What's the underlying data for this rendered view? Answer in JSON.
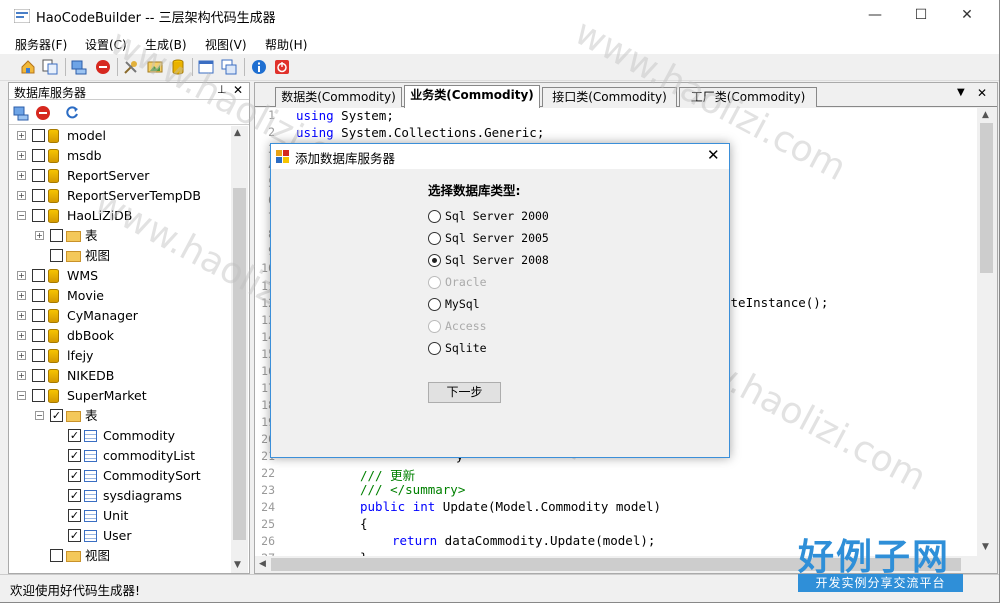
{
  "window": {
    "title": "HaoCodeBuilder -- 三层架构代码生成器",
    "minimize": "—",
    "maximize": "☐",
    "close": "✕"
  },
  "menu": [
    "服务器(F)",
    "设置(C)",
    "生成(B)",
    "视图(V)",
    "帮助(H)"
  ],
  "toolbar_icons": [
    "home-icon",
    "copy-icon",
    "server-add-icon",
    "stop-icon",
    "tools-icon",
    "image-icon",
    "database-icon",
    "window-icon",
    "windows-icon",
    "info-icon",
    "exit-icon"
  ],
  "left_panel": {
    "title": "数据库服务器",
    "pin": "⊥",
    "close": "✕",
    "tools": [
      "server-add-icon",
      "delete-icon",
      "refresh-icon"
    ],
    "tree": [
      {
        "label": "model",
        "level": 0,
        "type": "db",
        "expander": "+",
        "checked": false
      },
      {
        "label": "msdb",
        "level": 0,
        "type": "db",
        "expander": "+",
        "checked": false
      },
      {
        "label": "ReportServer",
        "level": 0,
        "type": "db",
        "expander": "+",
        "checked": false
      },
      {
        "label": "ReportServerTempDB",
        "level": 0,
        "type": "db",
        "expander": "+",
        "checked": false
      },
      {
        "label": "HaoLiZiDB",
        "level": 0,
        "type": "db",
        "expander": "−",
        "checked": false
      },
      {
        "label": "表",
        "level": 1,
        "type": "folder",
        "expander": "+",
        "checked": false
      },
      {
        "label": "视图",
        "level": 1,
        "type": "folder",
        "expander": "",
        "checked": false
      },
      {
        "label": "WMS",
        "level": 0,
        "type": "db",
        "expander": "+",
        "checked": false
      },
      {
        "label": "Movie",
        "level": 0,
        "type": "db",
        "expander": "+",
        "checked": false
      },
      {
        "label": "CyManager",
        "level": 0,
        "type": "db",
        "expander": "+",
        "checked": false
      },
      {
        "label": "dbBook",
        "level": 0,
        "type": "db",
        "expander": "+",
        "checked": false
      },
      {
        "label": "lfejy",
        "level": 0,
        "type": "db",
        "expander": "+",
        "checked": false
      },
      {
        "label": "NIKEDB",
        "level": 0,
        "type": "db",
        "expander": "+",
        "checked": false
      },
      {
        "label": "SuperMarket",
        "level": 0,
        "type": "db",
        "expander": "−",
        "checked": false
      },
      {
        "label": "表",
        "level": 1,
        "type": "folder",
        "expander": "−",
        "checked": true
      },
      {
        "label": "Commodity",
        "level": 2,
        "type": "table",
        "expander": "",
        "checked": true
      },
      {
        "label": "commodityList",
        "level": 2,
        "type": "table",
        "expander": "",
        "checked": true
      },
      {
        "label": "CommoditySort",
        "level": 2,
        "type": "table",
        "expander": "",
        "checked": true
      },
      {
        "label": "sysdiagrams",
        "level": 2,
        "type": "table",
        "expander": "",
        "checked": true
      },
      {
        "label": "Unit",
        "level": 2,
        "type": "table",
        "expander": "",
        "checked": true
      },
      {
        "label": "User",
        "level": 2,
        "type": "table",
        "expander": "",
        "checked": true
      },
      {
        "label": "视图",
        "level": 1,
        "type": "folder",
        "expander": "",
        "checked": false
      }
    ]
  },
  "editor": {
    "tabs": [
      {
        "label": "数据类(Commodity)",
        "active": false
      },
      {
        "label": "业务类(Commodity)",
        "active": true
      },
      {
        "label": "接口类(Commodity)",
        "active": false
      },
      {
        "label": "工厂类(Commodity)",
        "active": false
      }
    ],
    "tab_menu": "▼",
    "tab_close": "✕",
    "line_numbers": [
      "1",
      "2",
      "3",
      "4",
      "5",
      "6",
      "7",
      "8",
      "9",
      "10",
      "11",
      "12",
      "13",
      "14",
      "15",
      "16",
      "17",
      "18",
      "19",
      "20",
      "21",
      "22",
      "23",
      "24",
      "25",
      "26",
      "27"
    ],
    "code_visible": {
      "l1_kw": "using",
      "l1_rest": " System;",
      "l2_kw": "using",
      "l2_rest": " System.Collections.Generic;",
      "l12_tail": "ateInstance();",
      "l21_tail": "y",
      "l22_cm": "/// 更新",
      "l23_cm": "/// </summary>",
      "l24_kw1": "public",
      "l24_kw2": "int",
      "l24_rest": " Update(Model.Commodity model)",
      "l25": "{",
      "l26_kw": "return",
      "l26_rest": " dataCommodity.Update(model);",
      "l27": "}"
    }
  },
  "dialog": {
    "title": "添加数据库服务器",
    "close": "✕",
    "prompt": "选择数据库类型:",
    "options": [
      {
        "label": "Sql Server 2000",
        "selected": false,
        "enabled": true
      },
      {
        "label": "Sql Server 2005",
        "selected": false,
        "enabled": true
      },
      {
        "label": "Sql Server 2008",
        "selected": true,
        "enabled": true
      },
      {
        "label": "Oracle",
        "selected": false,
        "enabled": false
      },
      {
        "label": "MySql",
        "selected": false,
        "enabled": true
      },
      {
        "label": "Access",
        "selected": false,
        "enabled": false
      },
      {
        "label": "Sqlite",
        "selected": false,
        "enabled": true
      }
    ],
    "next_button": "下一步"
  },
  "status": {
    "text": "欢迎使用好代码生成器!"
  },
  "watermark": {
    "text": "www.haolizi.com",
    "brand_big": "好例子网",
    "brand_small": "开发实例分享交流平台"
  },
  "colors": {
    "accent": "#3b8fd9",
    "keyword": "#0000ff",
    "comment": "#008000",
    "brand": "#2f8fd8"
  }
}
